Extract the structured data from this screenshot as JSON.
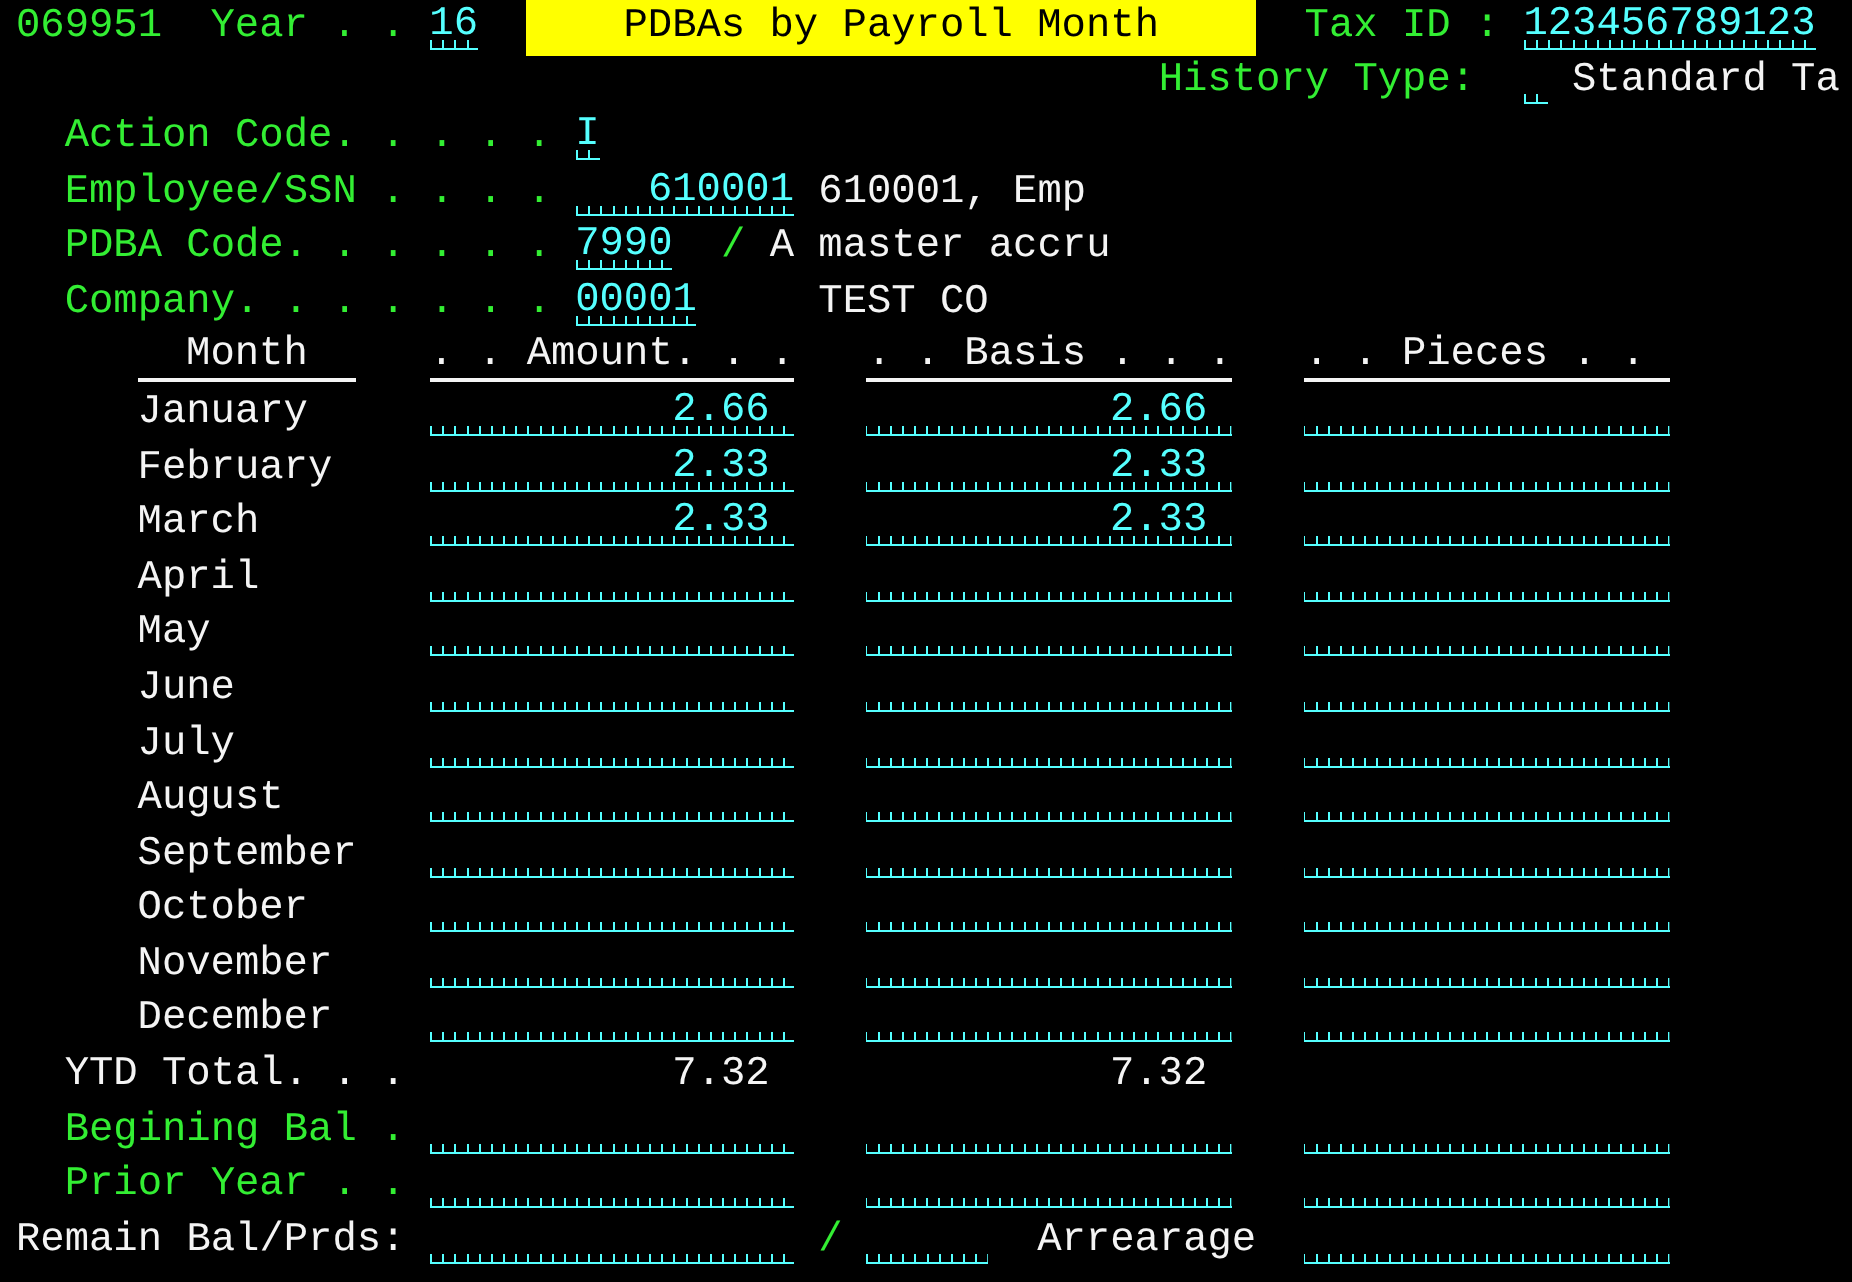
{
  "header": {
    "program": "069951",
    "year_label": "Year . .",
    "year": "16",
    "title": "PDBAs by Payroll Month",
    "tax_id_label": "Tax ID :",
    "tax_id": "123456789123"
  },
  "history": {
    "label": "History Type:",
    "description": "Standard Ta"
  },
  "action_code": {
    "label": "Action Code. . . . .",
    "value": "I"
  },
  "employee": {
    "label": "Employee/SSN . . . .",
    "value": "610001",
    "name": "610001, Emp"
  },
  "pdba": {
    "label": "PDBA Code. . . . . .",
    "value": "7990",
    "separator": "/",
    "description": "A master accru"
  },
  "company": {
    "label": "Company. . . . . . .",
    "value": "00001",
    "name": "TEST CO"
  },
  "columns": [
    "Month",
    ". . Amount. . .",
    ". . Basis . . .",
    ". . Pieces . ."
  ],
  "months": [
    {
      "month": "January",
      "amount": "2.66",
      "basis": "2.66"
    },
    {
      "month": "February",
      "amount": "2.33",
      "basis": "2.33"
    },
    {
      "month": "March",
      "amount": "2.33",
      "basis": "2.33"
    },
    {
      "month": "April"
    },
    {
      "month": "May"
    },
    {
      "month": "June"
    },
    {
      "month": "July"
    },
    {
      "month": "August"
    },
    {
      "month": "September"
    },
    {
      "month": "October"
    },
    {
      "month": "November"
    },
    {
      "month": "December"
    }
  ],
  "ytd": {
    "label": "YTD Total. . .",
    "amount": "7.32",
    "basis": "7.32"
  },
  "balances": [
    {
      "label": "Begining Bal ."
    },
    {
      "label": "Prior Year . ."
    }
  ],
  "remain": {
    "label": "Remain Bal/Prds:",
    "separator": "/",
    "arrearage_label": "Arrearage"
  }
}
